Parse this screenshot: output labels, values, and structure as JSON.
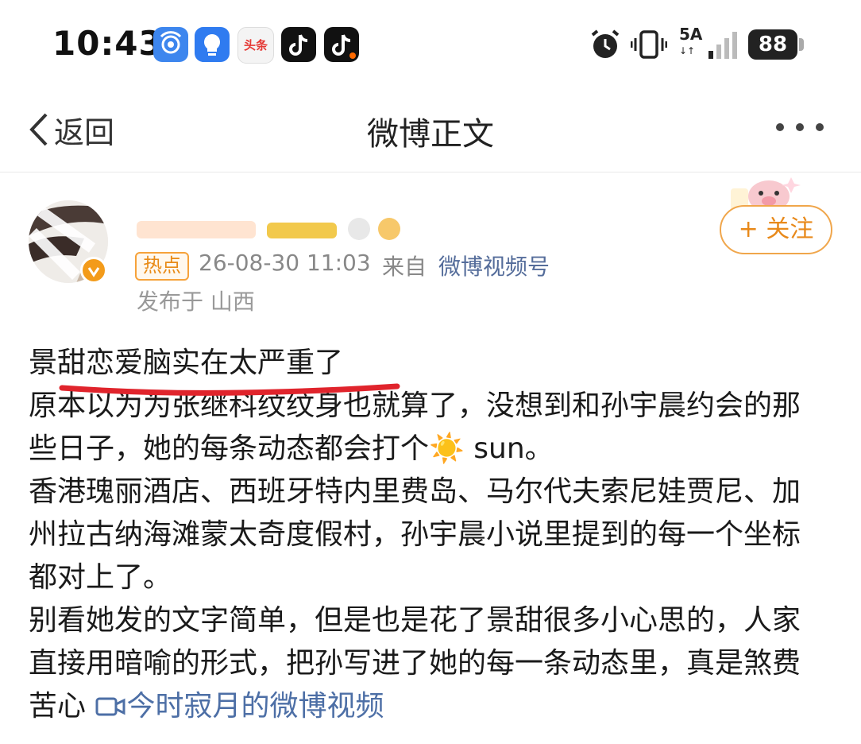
{
  "status_bar": {
    "time": "10:43",
    "app_icons": [
      "hotspot-icon",
      "bulb-app-icon",
      "toutiao-app-icon",
      "tiktok-app-icon",
      "tiktok-lite-app-icon"
    ],
    "toutiao_label": "头条",
    "network": "5A",
    "battery": "88"
  },
  "nav": {
    "back_label": "返回",
    "title": "微博正文"
  },
  "post": {
    "hot_badge": "热点",
    "time": "26-08-30 11:03",
    "source_prefix": "来自",
    "source": "微博视频号",
    "location": "发布于 山西",
    "follow_label": "+ 关注",
    "headline": "景甜恋爱脑实在太严重了",
    "paragraph1": "原本以为为张继科纹纹身也就算了，没想到和孙宇晨约会的那些日子，她的每条动态都会打个☀️ sun。",
    "paragraph2": " 香港瑰丽酒店、西班牙特内里费岛、马尔代夫索尼娃贾尼、加州拉古纳海滩蒙太奇度假村，孙宇晨小说里提到的每一个坐标都对上了。",
    "paragraph3": " 别看她发的文字简单，但是也是花了景甜很多小心思的，人家直接用暗喻的形式，把孙写进了她的每一条动态里，真是煞费苦心",
    "video_link": "今时寂月的微博视频"
  },
  "colors": {
    "accent_orange": "#f0a64b",
    "link_blue": "#4d6fa6",
    "underline_red": "#e0242c"
  }
}
